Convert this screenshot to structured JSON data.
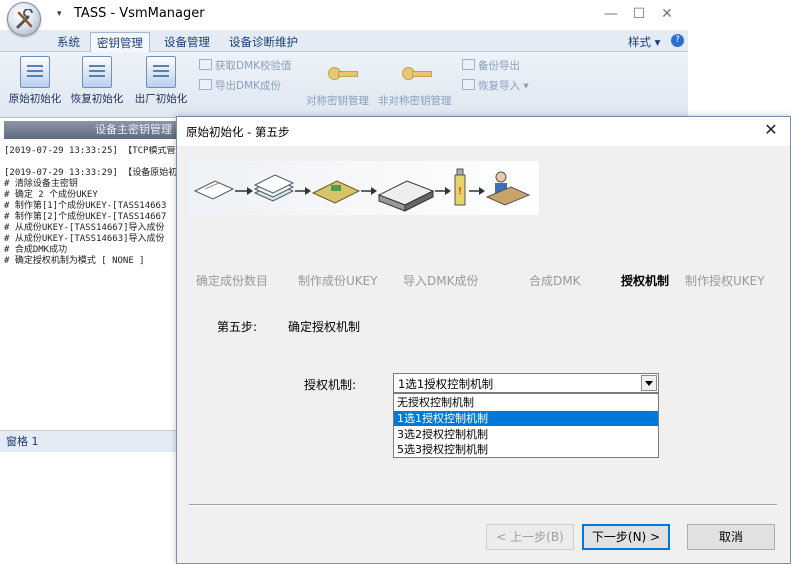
{
  "main_window": {
    "title": "TASS - VsmManager",
    "qat_arrow": "▾",
    "controls": {
      "minimize": "—",
      "maximize": "☐",
      "close": "✕"
    },
    "menu": [
      "系统",
      "密钥管理",
      "设备管理",
      "设备诊断维护"
    ],
    "active_menu": "密钥管理",
    "style_menu": "样式 ▾",
    "help_glyph": "?",
    "ribbon": {
      "big_buttons": [
        "原始初始化",
        "恢复初始化",
        "出厂初始化"
      ],
      "small_buttons_a": [
        "获取DMK校验值",
        "导出DMK成份"
      ],
      "key_buttons": [
        "对称密钥管理",
        "非对称密钥管理"
      ],
      "small_buttons_b": [
        "备份导出",
        "恢复导入 ▾"
      ]
    },
    "panel_header": "设备主密钥管理",
    "log_lines": [
      "[2019-07-29 13:33:25] 【TCP模式管理",
      "",
      "[2019-07-29 13:33:29] 【设备原始初始化",
      "# 清除设备主密钥",
      "# 确定 2 个成份UKEY",
      "# 制作第[1]个成份UKEY-[TASS14663",
      "# 制作第[2]个成份UKEY-[TASS14667",
      "# 从成份UKEY-[TASS14667]导入成份",
      "# 从成份UKEY-[TASS14663]导入成份",
      "# 合成DMK成功",
      "# 确定授权机制为模式 [ NONE ]"
    ],
    "status": "窗格 1"
  },
  "dialog": {
    "title": "原始初始化 - 第五步",
    "close_glyph": "✕",
    "steps": [
      "确定成份数目",
      "制作成份UKEY",
      "导入DMK成份",
      "合成DMK",
      "授权机制",
      "制作授权UKEY"
    ],
    "current_step_index": 4,
    "step_prefix": "第五步:",
    "step_desc": "确定授权机制",
    "field_label": "授权机制:",
    "combo_value": "1选1授权控制机制",
    "options": [
      "无授权控制机制",
      "1选1授权控制机制",
      "3选2授权控制机制",
      "5选3授权控制机制"
    ],
    "selected_option_index": 1,
    "buttons": {
      "back": "< 上一步(B)",
      "next": "下一步(N) >",
      "cancel": "取消"
    }
  }
}
